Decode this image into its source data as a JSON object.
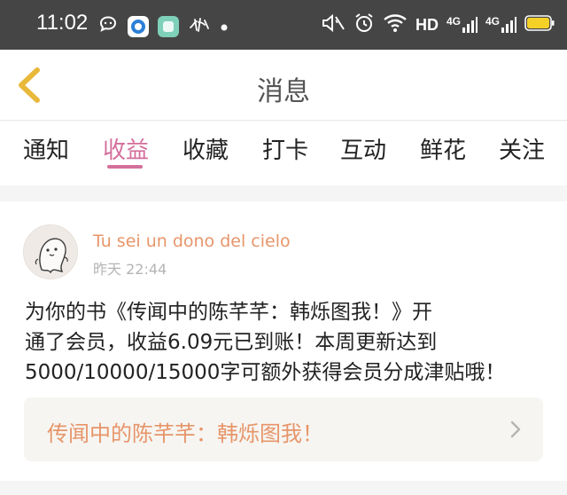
{
  "status_bar": {
    "time": "11:02",
    "hd_label": "HD",
    "net_label_1": "4G",
    "net_label_2": "4G",
    "icons": [
      "chat-bubble-icon",
      "blue-app-icon",
      "green-app-icon",
      "calligraphy-app-icon",
      "dot-icon",
      "mute-icon",
      "alarm-icon",
      "wifi-icon",
      "signal-icon",
      "battery-icon"
    ],
    "battery_level": 1.0
  },
  "header": {
    "title": "消息",
    "back_icon": "chevron-left-icon"
  },
  "tabs": [
    {
      "label": "通知",
      "active": false
    },
    {
      "label": "收益",
      "active": true
    },
    {
      "label": "收藏",
      "active": false
    },
    {
      "label": "打卡",
      "active": false
    },
    {
      "label": "互动",
      "active": false
    },
    {
      "label": "鲜花",
      "active": false
    },
    {
      "label": "关注",
      "active": false
    }
  ],
  "message": {
    "author": "Tu sei un dono del cielo",
    "time": "昨天 22:44",
    "lines": [
      "为你的书《传闻中的陈芊芊：韩烁图我！》开",
      "通了会员，收益6.09元已到账！本周更新达到",
      "5000/10000/15000字可额外获得会员分成津贴哦！"
    ],
    "book_title": "传闻中的陈芊芊：韩烁图我！"
  },
  "colors": {
    "accent_pink": "#d46f9c",
    "accent_orange": "#e7956a",
    "back_arrow": "#e8b83a",
    "status_bar_bg": "#454545",
    "battery": "#f5d027"
  }
}
